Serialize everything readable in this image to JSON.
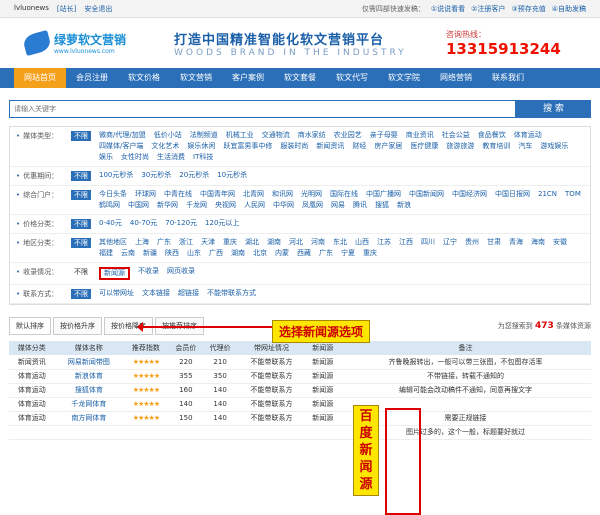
{
  "topbar": {
    "site": "lvluonews",
    "switch": "[站长]",
    "logout": "安全退出",
    "links": [
      "仅需四部快速发稿：",
      "①说说看看",
      "②注册客户",
      "③预存充值",
      "④自助发稿"
    ]
  },
  "header": {
    "logo_cn": "绿萝软文营销",
    "logo_url": "www.lvluonews.com",
    "slogan_cn": "打造中国精准智能化软文营销平台",
    "slogan_en": "WOODS BRAND IN THE INDUSTRY",
    "hotline_label": "咨询热线：",
    "hotline": "13315913244"
  },
  "nav": [
    "网站首页",
    "会员注册",
    "软文价格",
    "软文营销",
    "客户案例",
    "软文套餐",
    "软文代写",
    "软文学院",
    "网络营销",
    "联系我们"
  ],
  "search": {
    "placeholder": "请输入关键字",
    "button": "搜 索"
  },
  "filters": [
    {
      "label": "媒体类型：",
      "nolimit": "不限",
      "options": [
        "微商/代理/加盟",
        "低价小站",
        "法制频道",
        "机械工业",
        "交通物流",
        "商水家纺",
        "农业园艺",
        "亲子母婴",
        "商业资讯",
        "社会公益",
        "食品餐饮",
        "体育运动",
        "四媒体/客户端",
        "文化艺术",
        "娱乐休闲",
        "跃宜富男事中修",
        "服装时尚",
        "新闻资讯",
        "财经",
        "房产家居",
        "医疗健康",
        "旅游旅游",
        "教育培训",
        "汽车",
        "游戏娱乐",
        "娱乐",
        "女性时尚",
        "生活消费",
        "IT科技"
      ]
    },
    {
      "label": "优惠期间：",
      "nolimit": "不限",
      "options": [
        "100元秒杀",
        "30元秒杀",
        "20元秒杀",
        "10元秒杀"
      ]
    },
    {
      "label": "综合门户：",
      "nolimit": "不限",
      "options": [
        "今日头条",
        "环球网",
        "中青在线",
        "中国青年网",
        "北青网",
        "和讯网",
        "光明网",
        "国际在线",
        "中国广播网",
        "中国新闻网",
        "中国经济网",
        "中国日报网",
        "21CN",
        "TOM",
        "鹤鸣网",
        "中国网",
        "新华网",
        "千龙网",
        "央视网",
        "人民网",
        "中华网",
        "凤凰网",
        "网易",
        "腾讯",
        "搜狐",
        "新浪"
      ]
    },
    {
      "label": "价格分类：",
      "nolimit": "不限",
      "options": [
        "0-40元",
        "40-70元",
        "70-120元",
        "120元以上"
      ]
    },
    {
      "label": "地区分类：",
      "nolimit": "不限",
      "options": [
        "其他地区",
        "上海",
        "广东",
        "浙江",
        "天津",
        "重庆",
        "湖北",
        "湖南",
        "河北",
        "河南",
        "东北",
        "山西",
        "江苏",
        "江西",
        "四川",
        "辽宁",
        "贵州",
        "甘肃",
        "青海",
        "海南",
        "安徽",
        "福建",
        "云南",
        "新疆",
        "陕西",
        "山东",
        "广西",
        "湖南",
        "北京",
        "内蒙",
        "西藏",
        "广东",
        "宁夏",
        "重庆"
      ]
    },
    {
      "label": "收录情况：",
      "nolimit": "不限",
      "options": [
        "新闻源",
        "不收录",
        "网页收录"
      ],
      "selected": "新闻源"
    },
    {
      "label": "联系方式：",
      "nolimit": "不限",
      "options": [
        "可以带网址",
        "文本链接",
        "超链接",
        "不能带联系方式"
      ]
    }
  ],
  "callout": "选择新闻源选项",
  "vertical_callout": "百度新闻源",
  "sort": {
    "tabs": [
      "默认排序",
      "按价格升序",
      "按价格降序",
      "按推荐排序"
    ],
    "count_prefix": "为您搜索到",
    "count": "473",
    "count_suffix": "条媒体资源"
  },
  "table": {
    "headers": [
      "媒体分类",
      "媒体名称",
      "推荐指数",
      "会员价",
      "代理价",
      "带网址情况",
      "新闻源",
      "备注"
    ],
    "rows": [
      [
        "新闻资讯",
        "网易新闻带图",
        "★★★★★",
        "220",
        "210",
        "不能带联系方",
        "新闻源",
        "齐鲁晚报转出，一般可以带三张图，不包图存活率"
      ],
      [
        "体育运动",
        "新浪体育",
        "★★★★★",
        "355",
        "350",
        "不能带联系方",
        "新闻源",
        "不带链接，转载不通知的"
      ],
      [
        "体育运动",
        "搜狐体育",
        "★★★★★",
        "160",
        "140",
        "不能带联系方",
        "新闻源",
        "编辑可能会改动稿件不通知，同意再搜文字"
      ],
      [
        "体育运动",
        "千龙网体育",
        "★★★★★",
        "140",
        "140",
        "不能带联系方",
        "新闻源",
        ""
      ],
      [
        "体育运动",
        "南方网体育",
        "★★★★★",
        "150",
        "140",
        "不能带联系方",
        "新闻源",
        "需要正规链接"
      ],
      [
        "",
        "",
        "",
        "",
        "",
        "",
        "",
        "图片过多的，这个一般，标题要好就过"
      ]
    ]
  }
}
